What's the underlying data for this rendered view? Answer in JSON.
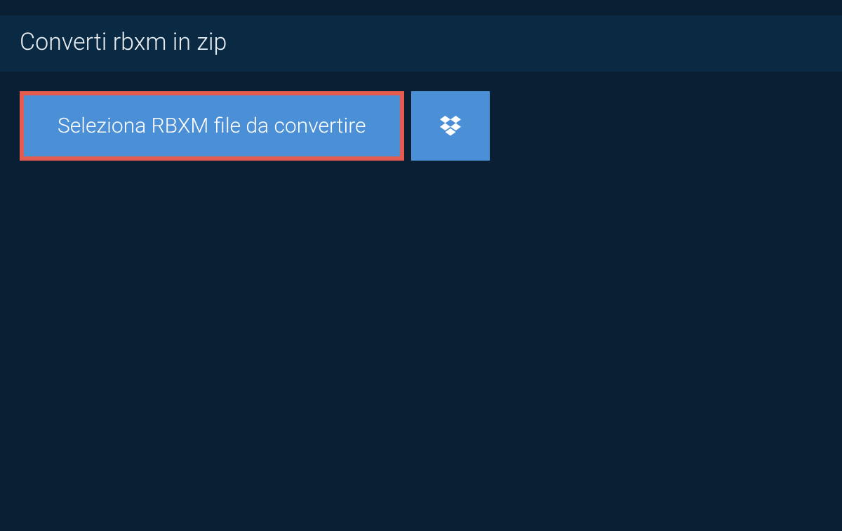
{
  "title_tab": {
    "label": "Converti rbxm in zip"
  },
  "actions": {
    "select_file_label": "Seleziona RBXM file da convertire",
    "dropbox_icon_name": "dropbox-icon"
  },
  "colors": {
    "bg_dark": "#081f34",
    "bg_mid": "#0a2a43",
    "button_blue": "#4b8fd6",
    "highlight_border": "#e45b50"
  }
}
